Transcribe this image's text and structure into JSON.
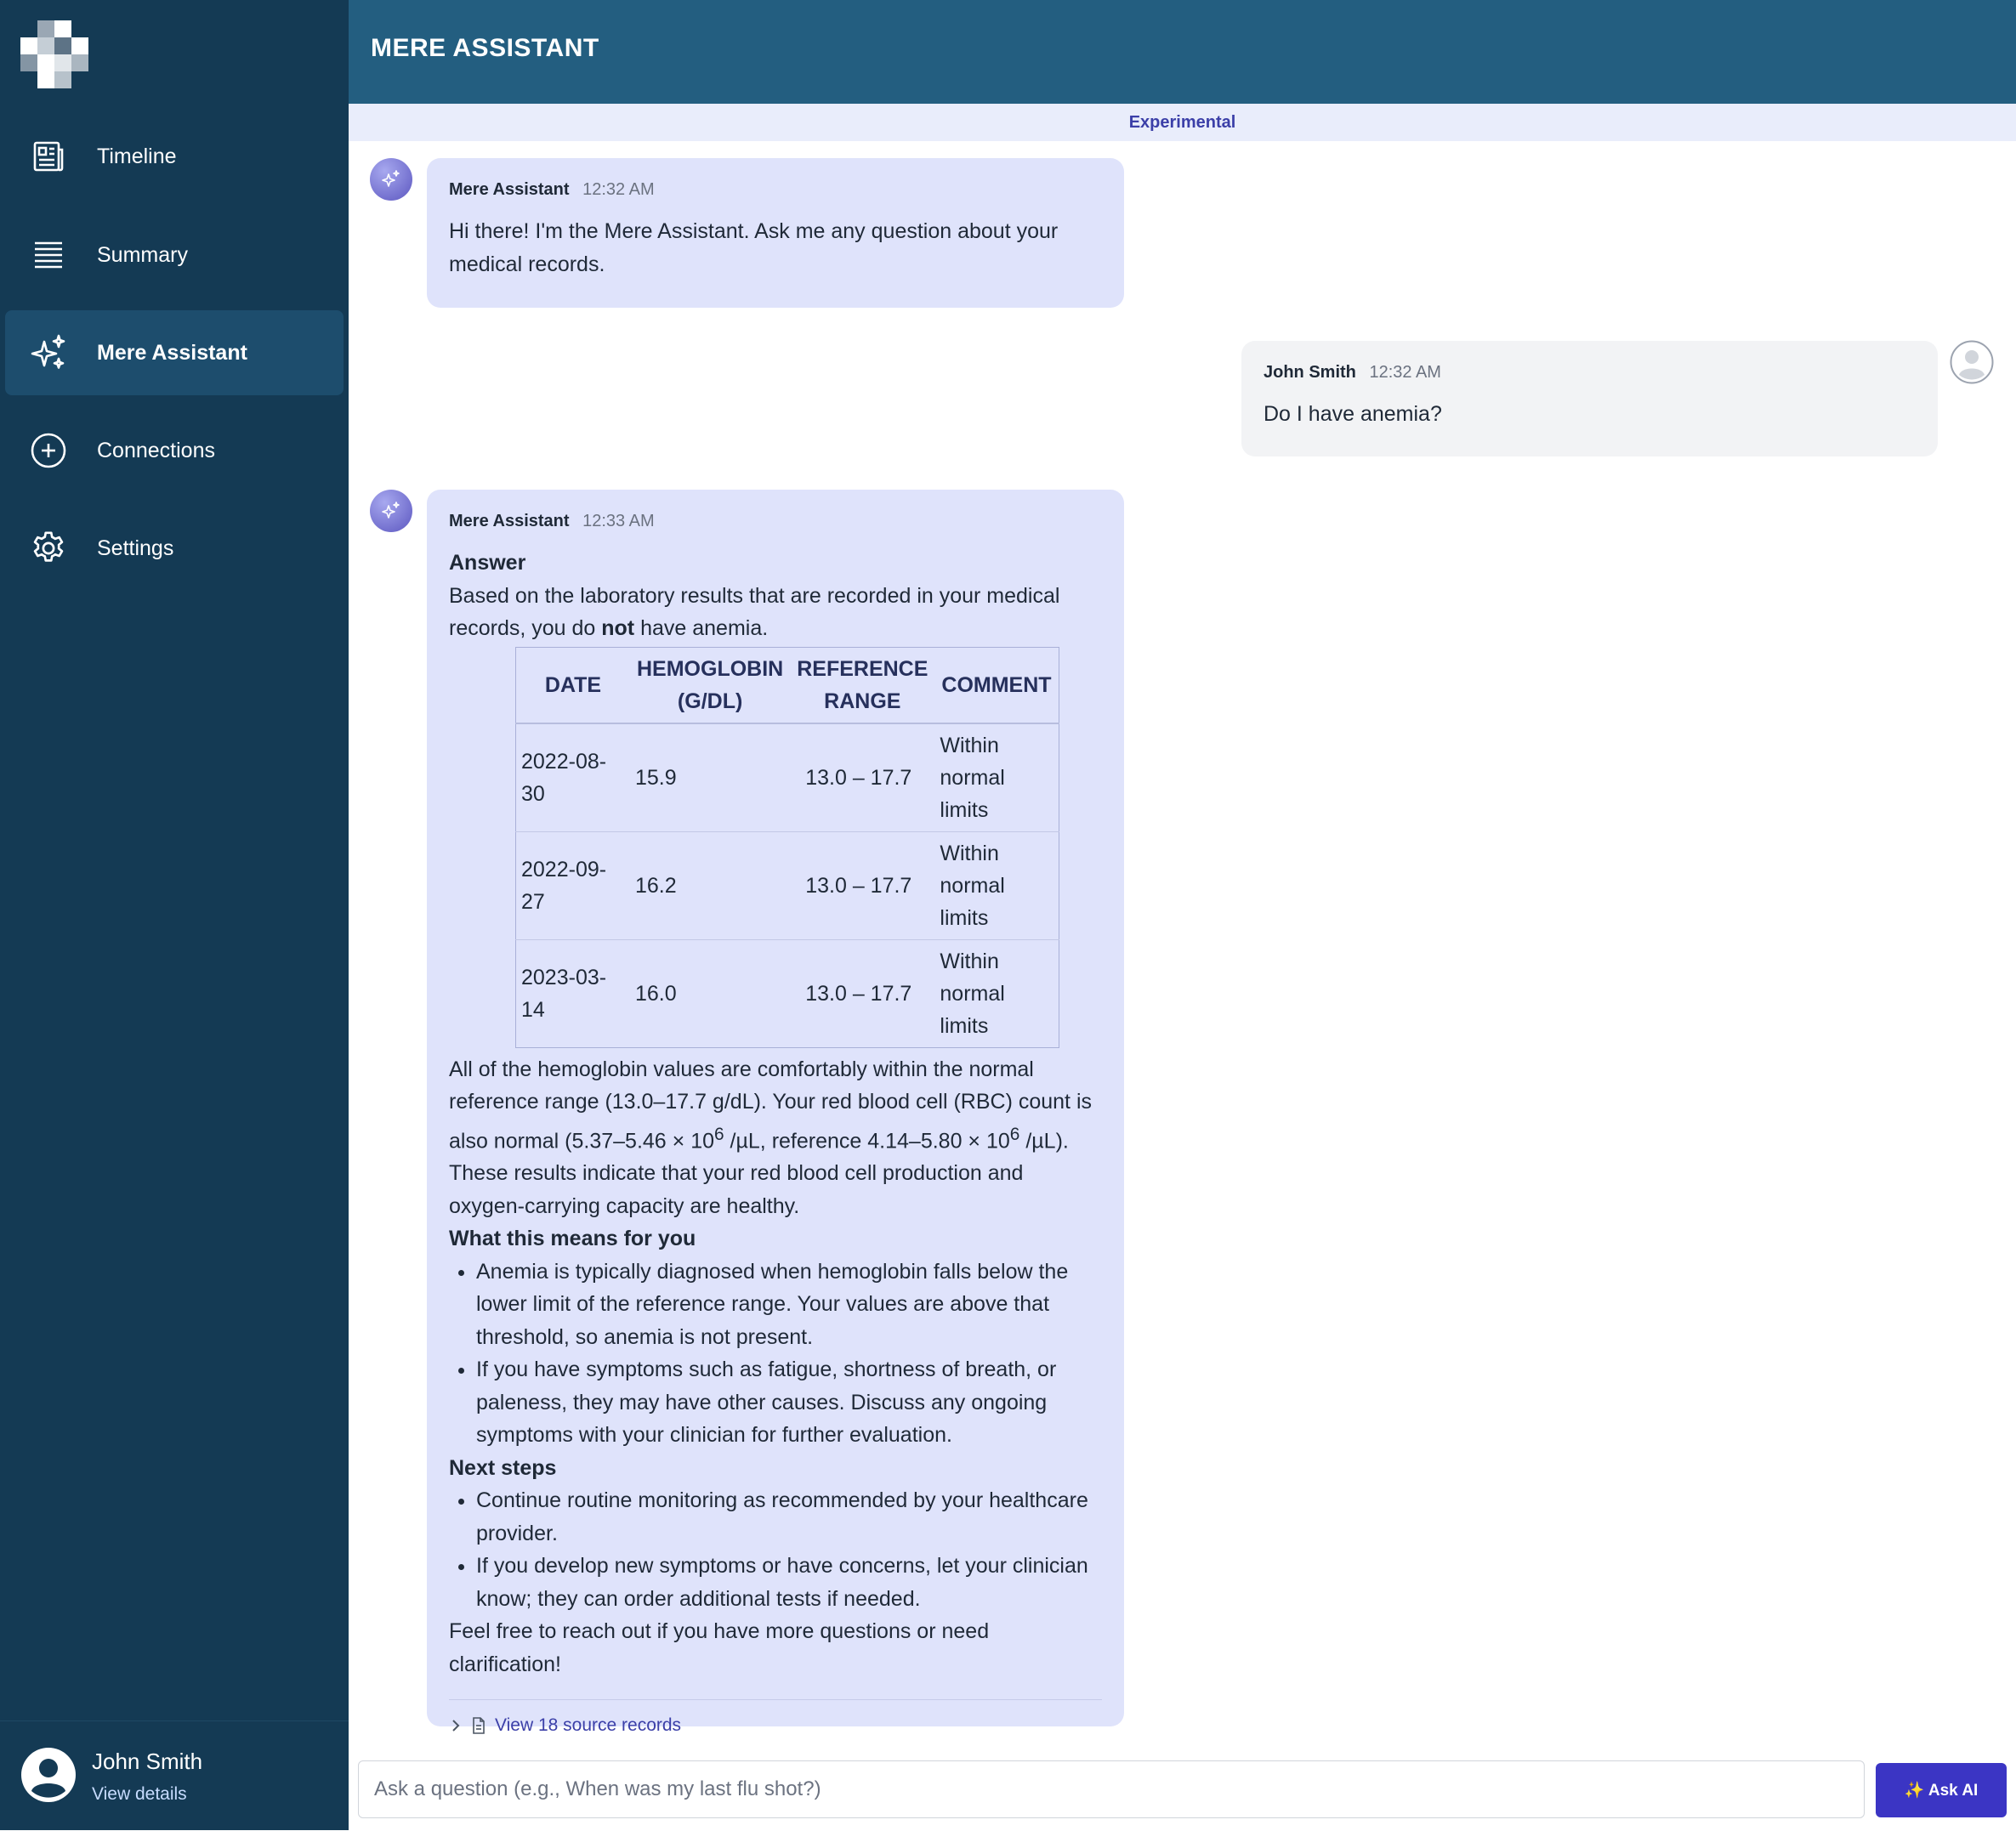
{
  "app": {
    "title": "MERE ASSISTANT",
    "experimental_label": "Experimental"
  },
  "sidebar": {
    "items": [
      {
        "label": "Timeline",
        "icon": "timeline-icon"
      },
      {
        "label": "Summary",
        "icon": "list-icon"
      },
      {
        "label": "Mere Assistant",
        "icon": "sparkles-icon",
        "active": true
      },
      {
        "label": "Connections",
        "icon": "plus-circle-icon"
      },
      {
        "label": "Settings",
        "icon": "gear-icon"
      }
    ],
    "user": {
      "name": "John Smith",
      "link": "View details"
    }
  },
  "messages": {
    "m1": {
      "sender": "Mere Assistant",
      "time": "12:32 AM",
      "text": "Hi there! I'm the Mere Assistant. Ask me any question about your medical records."
    },
    "m2": {
      "sender": "John Smith",
      "time": "12:32 AM",
      "text": "Do I have anemia?"
    },
    "m3": {
      "sender": "Mere Assistant",
      "time": "12:33 AM",
      "answer_heading": "Answer",
      "answer_pre": "Based on the laboratory results that are recorded in your medical records, you do ",
      "answer_bold": "not",
      "answer_post": " have anemia.",
      "table": {
        "headers": [
          "Date",
          "Hemoglobin (g/dL)",
          "Reference Range",
          "Comment"
        ],
        "rows": [
          [
            "2022-08-30",
            "15.9",
            "13.0 – 17.7",
            "Within normal limits"
          ],
          [
            "2022-09-27",
            "16.2",
            "13.0 – 17.7",
            "Within normal limits"
          ],
          [
            "2023-03-14",
            "16.0",
            "13.0 – 17.7",
            "Within normal limits"
          ]
        ]
      },
      "para2_a": "All of the hemoglobin values are comfortably within the normal reference range (13.0–17.7 g/dL). Your red blood cell (RBC) count is also normal (5.37–5.46 × 10",
      "sup1": "6",
      "para2_b": " /µL, reference 4.14–5.80 × 10",
      "sup2": "6",
      "para2_c": " /µL). These results indicate that your red blood cell production and oxygen-carrying capacity are healthy.",
      "means_heading": "What this means for you",
      "means": [
        "Anemia is typically diagnosed when hemoglobin falls below the lower limit of the reference range. Your values are above that threshold, so anemia is not present.",
        "If you have symptoms such as fatigue, shortness of breath, or paleness, they may have other causes. Discuss any ongoing symptoms with your clinician for further evaluation."
      ],
      "next_heading": "Next steps",
      "next": [
        "Continue routine monitoring as recommended by your healthcare provider.",
        "If you develop new symptoms or have concerns, let your clinician know; they can order additional tests if needed."
      ],
      "closing": "Feel free to reach out if you have more questions or need clarification!",
      "sources_label": "View 18 source records"
    }
  },
  "input": {
    "placeholder": "Ask a question (e.g., When was my last flu shot?)",
    "value": ""
  },
  "ask_button": "✨ Ask AI",
  "colors": {
    "sidebar": "#143a54",
    "header": "#235e80",
    "bot_bubble": "#dfe3fb",
    "user_bubble": "#f2f3f5",
    "accent": "#3b35c4"
  }
}
